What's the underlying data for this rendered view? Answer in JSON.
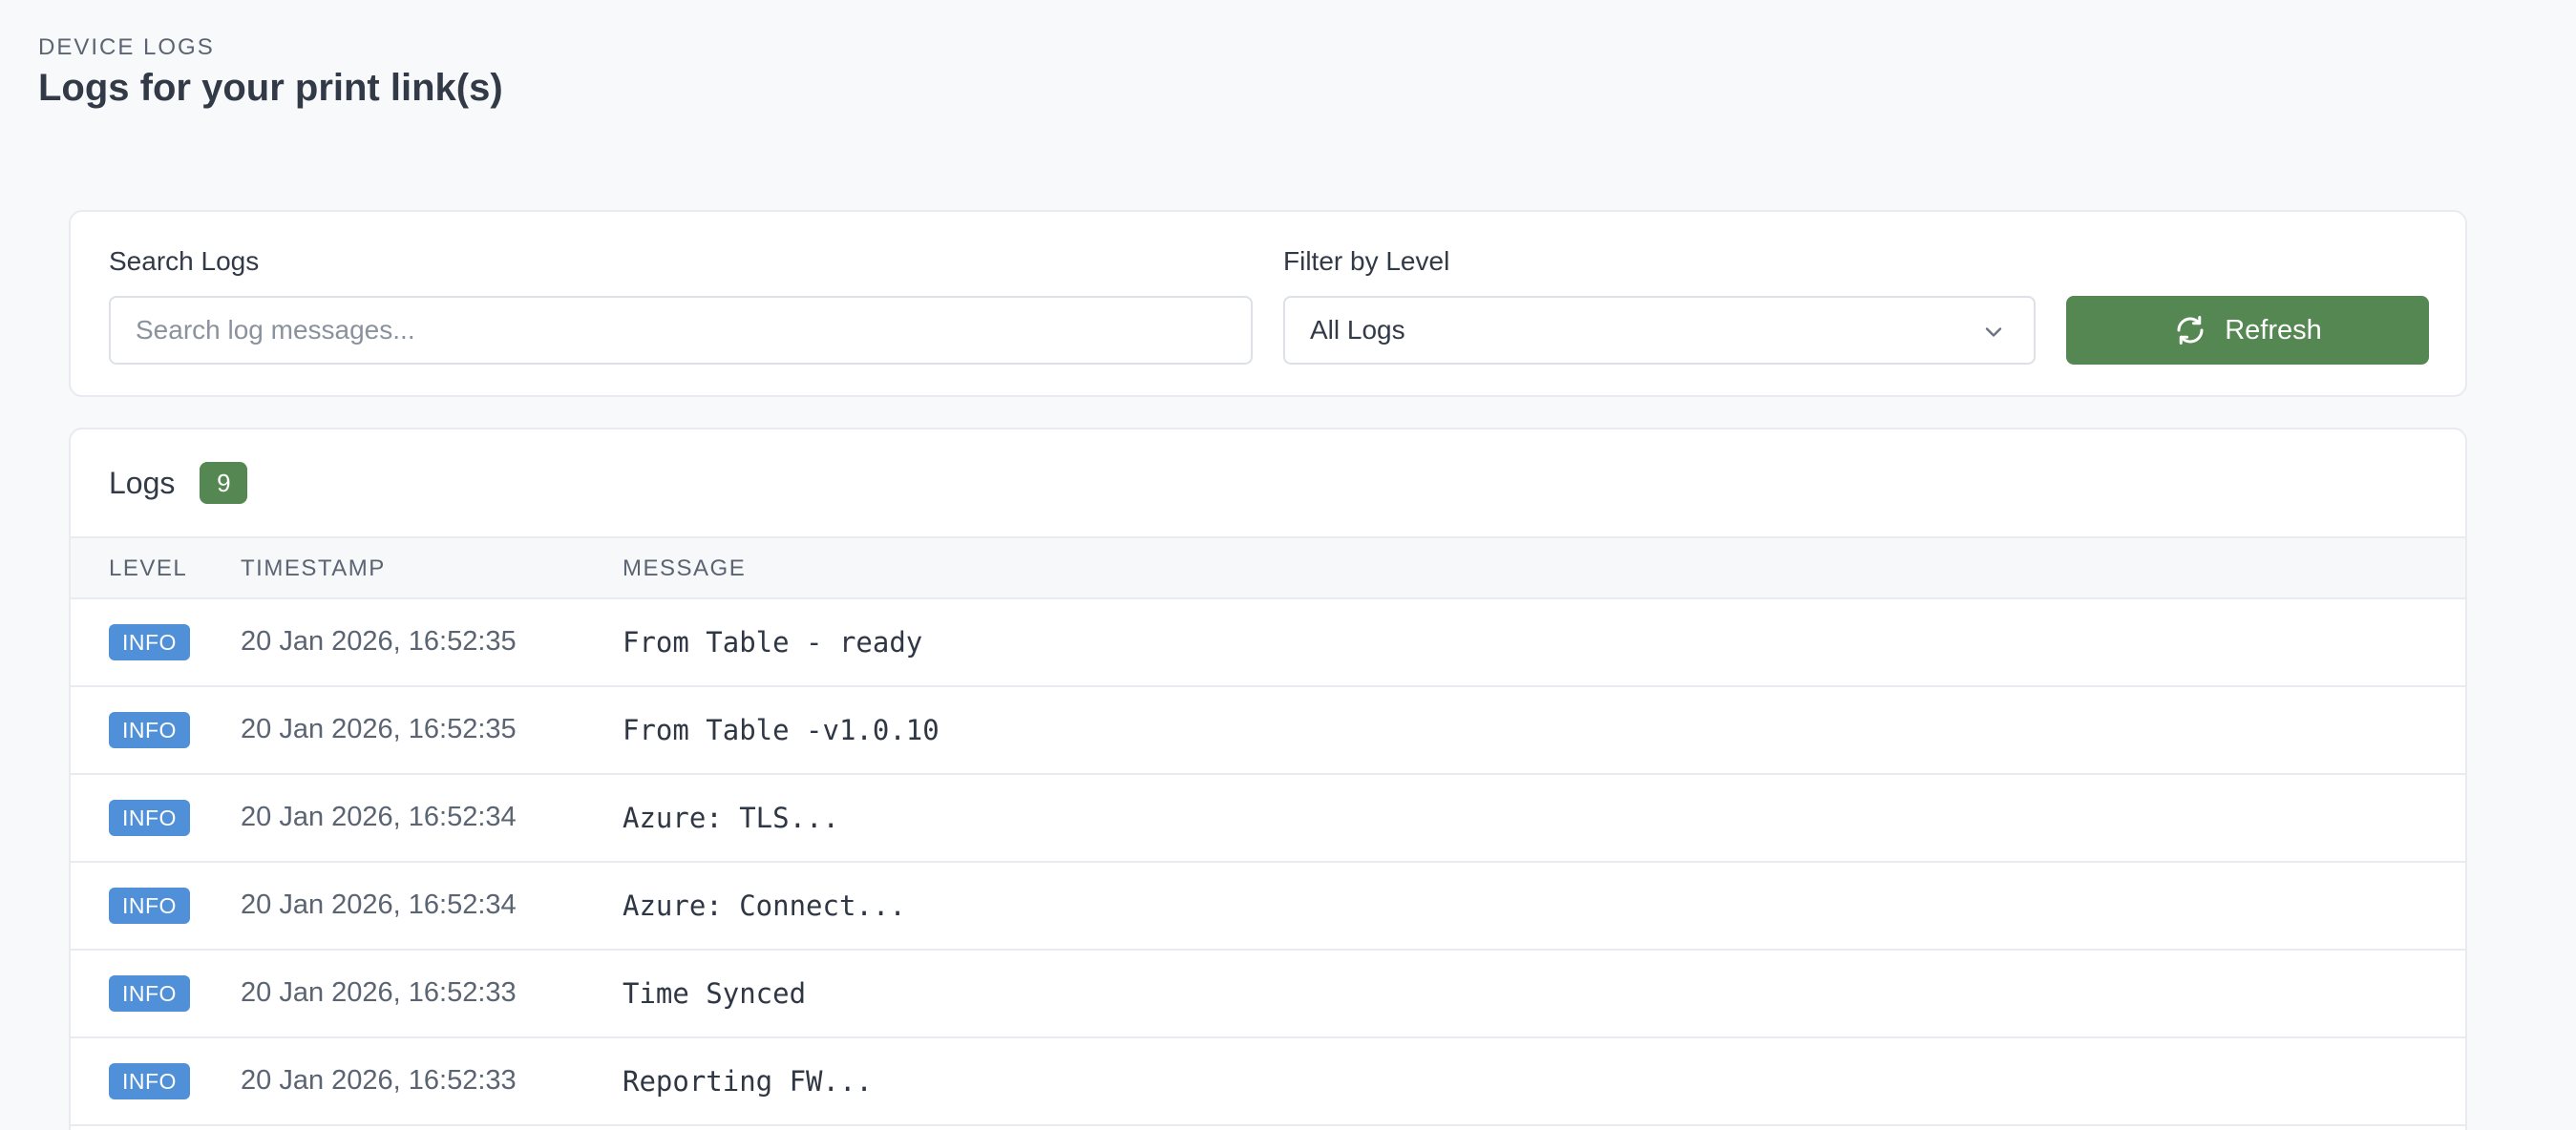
{
  "header": {
    "eyebrow": "DEVICE LOGS",
    "title": "Logs for your print link(s)"
  },
  "filters": {
    "search_label": "Search Logs",
    "search_placeholder": "Search log messages...",
    "search_value": "",
    "level_label": "Filter by Level",
    "level_selected": "All Logs",
    "refresh_label": "Refresh"
  },
  "logs": {
    "title": "Logs",
    "count": "9",
    "columns": {
      "level": "LEVEL",
      "timestamp": "TIMESTAMP",
      "message": "MESSAGE"
    },
    "rows": [
      {
        "level": "INFO",
        "timestamp": "20 Jan 2026, 16:52:35",
        "message": "From Table - ready"
      },
      {
        "level": "INFO",
        "timestamp": "20 Jan 2026, 16:52:35",
        "message": "From Table -v1.0.10"
      },
      {
        "level": "INFO",
        "timestamp": "20 Jan 2026, 16:52:34",
        "message": "Azure: TLS..."
      },
      {
        "level": "INFO",
        "timestamp": "20 Jan 2026, 16:52:34",
        "message": "Azure: Connect..."
      },
      {
        "level": "INFO",
        "timestamp": "20 Jan 2026, 16:52:33",
        "message": "Time Synced"
      },
      {
        "level": "INFO",
        "timestamp": "20 Jan 2026, 16:52:33",
        "message": "Reporting FW..."
      }
    ]
  },
  "colors": {
    "accent_green": "#558752",
    "info_blue": "#4f90d9"
  },
  "icons": {
    "refresh": "refresh-icon",
    "dropdown": "chevron-down-icon"
  }
}
